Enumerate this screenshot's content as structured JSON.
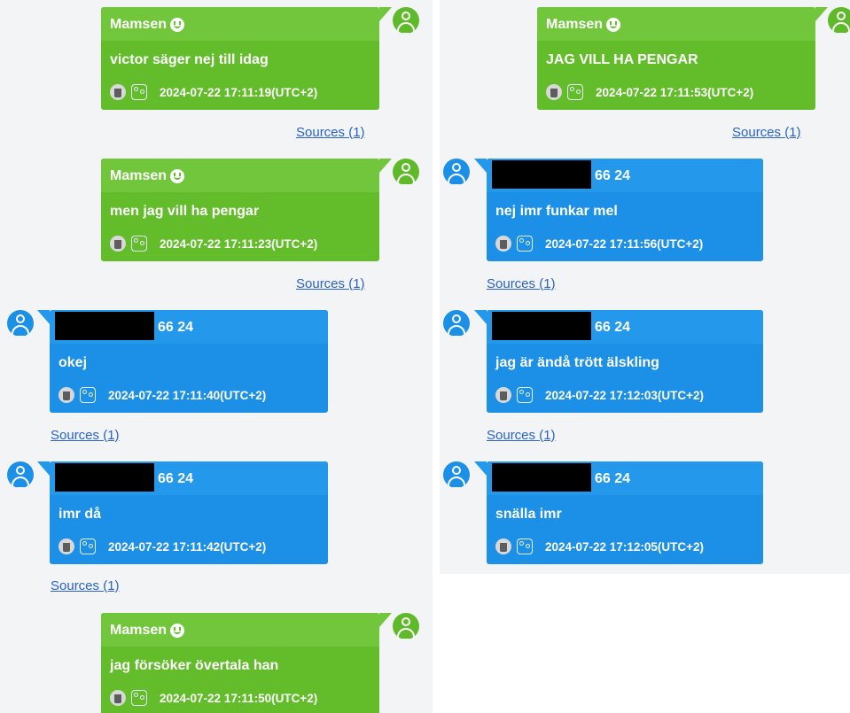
{
  "left": {
    "messages": [
      {
        "type": "sent",
        "sender": "Mamsen",
        "text": "victor säger nej till idag",
        "timestamp": "2024-07-22 17:11:19(UTC+2)",
        "sources": "Sources (1)"
      },
      {
        "type": "sent",
        "sender": "Mamsen",
        "text": "men jag vill ha pengar",
        "timestamp": "2024-07-22 17:11:23(UTC+2)",
        "sources": "Sources (1)"
      },
      {
        "type": "received",
        "number": "66 24",
        "text": "okej",
        "timestamp": "2024-07-22 17:11:40(UTC+2)",
        "sources": "Sources (1)"
      },
      {
        "type": "received",
        "number": "66 24",
        "text": "imr då",
        "timestamp": "2024-07-22 17:11:42(UTC+2)",
        "sources": "Sources (1)"
      },
      {
        "type": "sent",
        "sender": "Mamsen",
        "text": "jag försöker övertala han",
        "timestamp": "2024-07-22 17:11:50(UTC+2)"
      }
    ]
  },
  "right": {
    "messages": [
      {
        "type": "sent",
        "sender": "Mamsen",
        "text": "JAG VILL HA PENGAR",
        "timestamp": "2024-07-22 17:11:53(UTC+2)",
        "sources": "Sources (1)"
      },
      {
        "type": "received",
        "number": "66 24",
        "text": "nej imr funkar mel",
        "timestamp": "2024-07-22 17:11:56(UTC+2)",
        "sources": "Sources (1)"
      },
      {
        "type": "received",
        "number": "66 24",
        "text": "jag är ändå trött älskling",
        "timestamp": "2024-07-22 17:12:03(UTC+2)",
        "sources": "Sources (1)"
      },
      {
        "type": "received",
        "number": "66 24",
        "text": "snälla imr",
        "timestamp": "2024-07-22 17:12:05(UTC+2)"
      }
    ]
  },
  "colors": {
    "sent_bubble": "#63bd2b",
    "received_bubble": "#1c8fe6",
    "link": "#2a62c9"
  },
  "icons": {
    "sender_emoji": "smiley-icon",
    "delete": "trash-icon",
    "participants": "people-icon",
    "avatar": "user-avatar-icon"
  }
}
